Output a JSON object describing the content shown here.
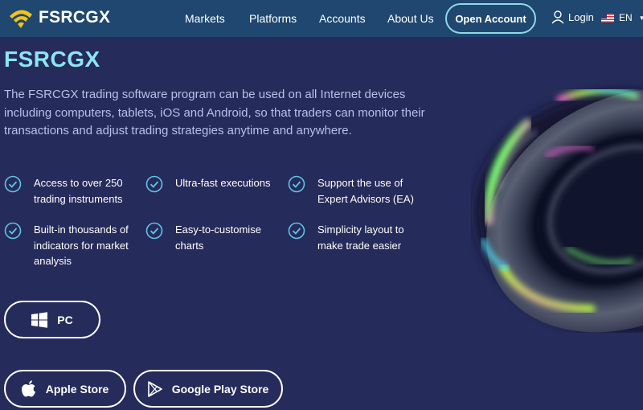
{
  "header": {
    "logo_text": "FSRCGX",
    "nav": [
      "Markets",
      "Platforms",
      "Accounts",
      "About Us"
    ],
    "open_account": "Open Account",
    "login": "Login",
    "language": "EN"
  },
  "hero": {
    "title": "FSRCGX",
    "description": "The FSRCGX trading software program can be used on all Internet devices including computers, tablets, iOS and Android, so that traders can monitor their transactions and adjust trading strategies anytime and anywhere."
  },
  "features": [
    "Access to over 250 trading instruments",
    "Ultra-fast executions",
    "Support the use of Expert Advisors (EA)",
    "Built-in thousands of indicators for market analysis",
    "Easy-to-customise charts",
    "Simplicity layout to make trade easier"
  ],
  "downloads": {
    "pc": "PC",
    "apple": "Apple Store",
    "google": "Google Play Store"
  },
  "colors": {
    "background": "#252b5a",
    "header": "#1f4770",
    "accent": "#8ee4f2",
    "check": "#5fc4e8"
  }
}
